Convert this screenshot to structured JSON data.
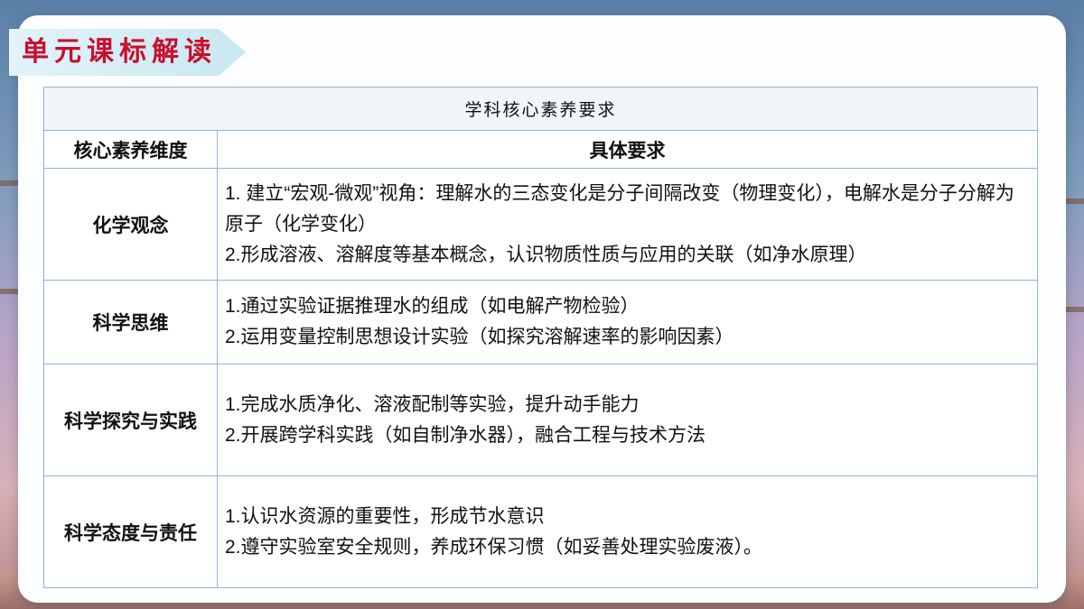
{
  "title": "单元课标解读",
  "table": {
    "caption": "学科核心素养要求",
    "headers": [
      "核心素养维度",
      "具体要求"
    ],
    "rows": [
      {
        "dimension": "化学观念",
        "requirements": [
          "1. 建立“宏观-微观”视角：理解水的三态变化是分子间隔改变（物理变化），电解水是分子分解为原子（化学变化）",
          "2.形成溶液、溶解度等基本概念，认识物质性质与应用的关联（如净水原理）"
        ]
      },
      {
        "dimension": "科学思维",
        "requirements": [
          "1.通过实验证据推理水的组成（如电解产物检验）",
          "2.运用变量控制思想设计实验（如探究溶解速率的影响因素）"
        ]
      },
      {
        "dimension": "科学探究与实践",
        "requirements": [
          "1.完成水质净化、溶液配制等实验，提升动手能力",
          "2.开展跨学科实践（如自制净水器），融合工程与技术方法"
        ]
      },
      {
        "dimension": "科学态度与责任",
        "requirements": [
          "1.认识水资源的重要性，形成节水意识",
          "2.遵守实验室安全规则，养成环保习惯（如妥善处理实验废液）。"
        ]
      }
    ]
  }
}
